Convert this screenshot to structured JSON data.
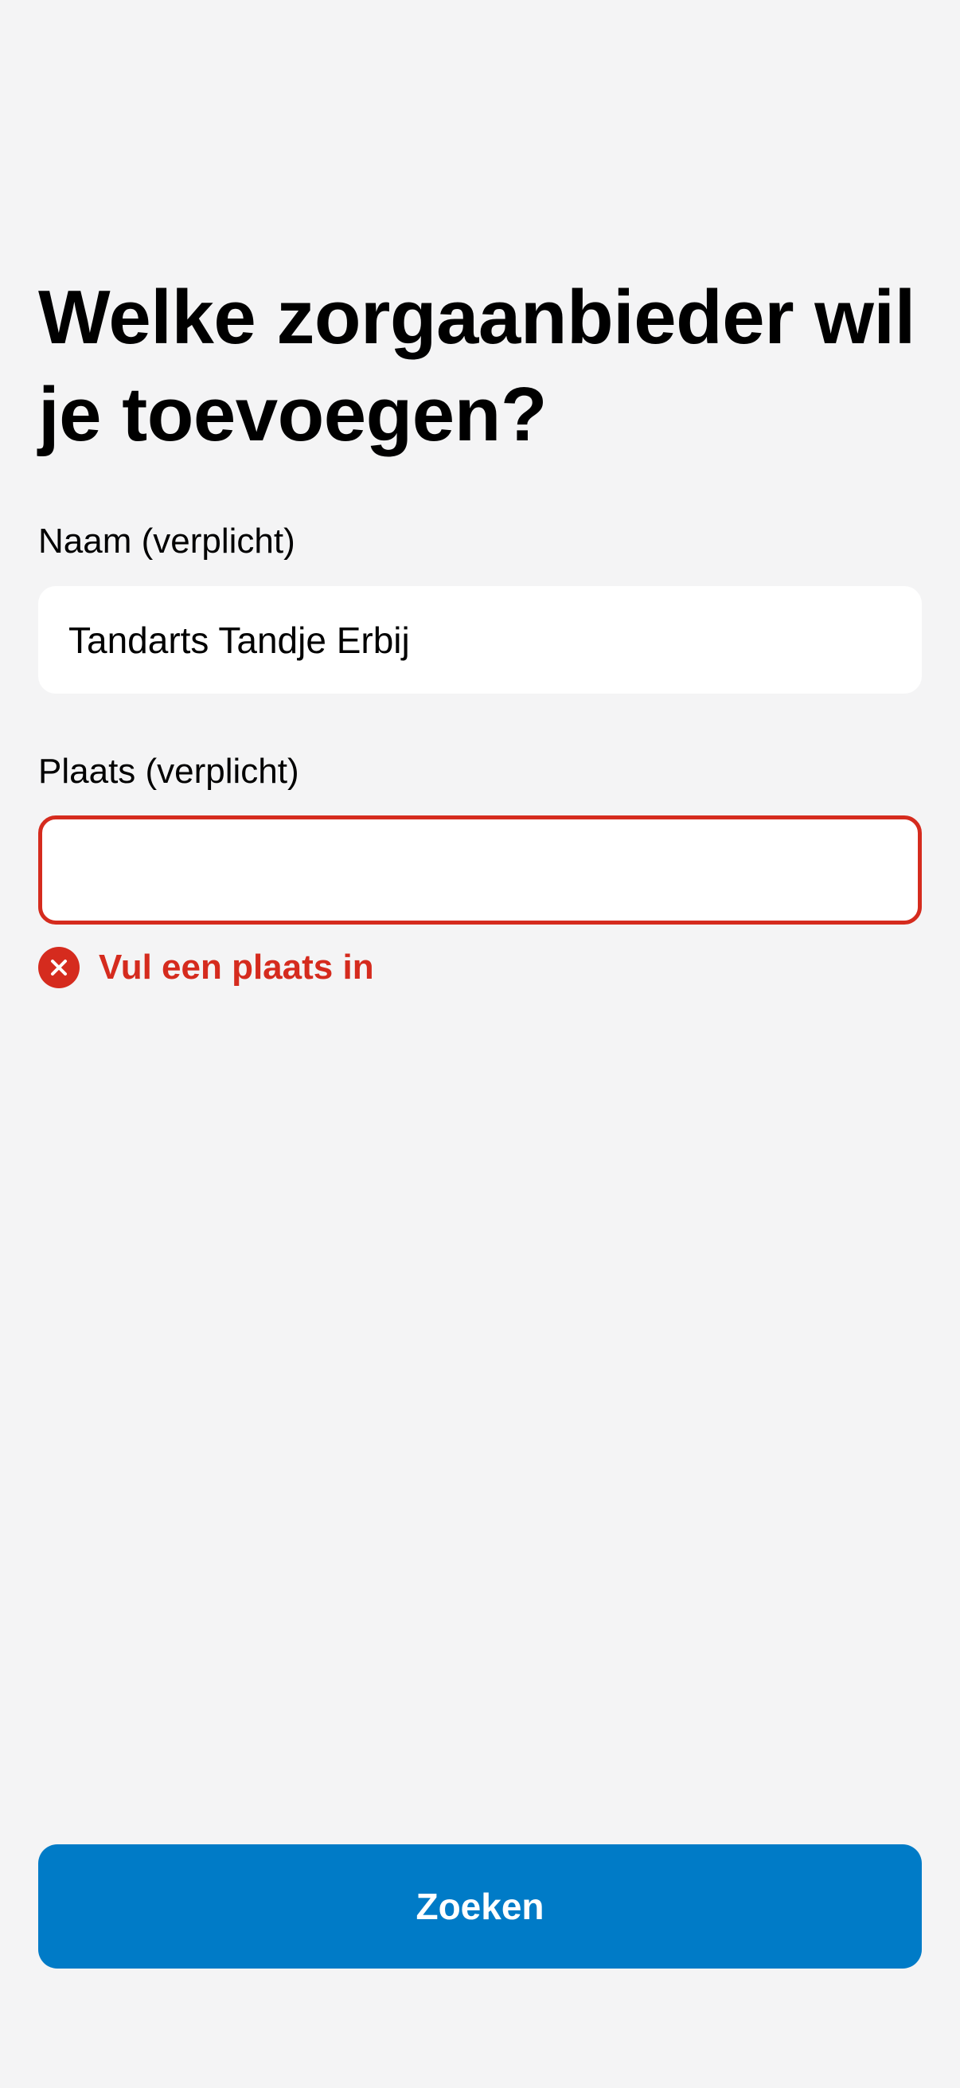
{
  "page": {
    "title": "Welke zorgaanbieder wil je toevoegen?"
  },
  "form": {
    "naam": {
      "label": "Naam (verplicht)",
      "value": "Tandarts Tandje Erbij",
      "placeholder": ""
    },
    "plaats": {
      "label": "Plaats (verplicht)",
      "value": "",
      "placeholder": "",
      "error": "Vul een plaats in"
    }
  },
  "actions": {
    "search_label": "Zoeken"
  },
  "colors": {
    "background": "#f4f4f5",
    "error": "#d52b1e",
    "primary": "#007bc7"
  },
  "icons": {
    "error": "close-circle-icon"
  }
}
